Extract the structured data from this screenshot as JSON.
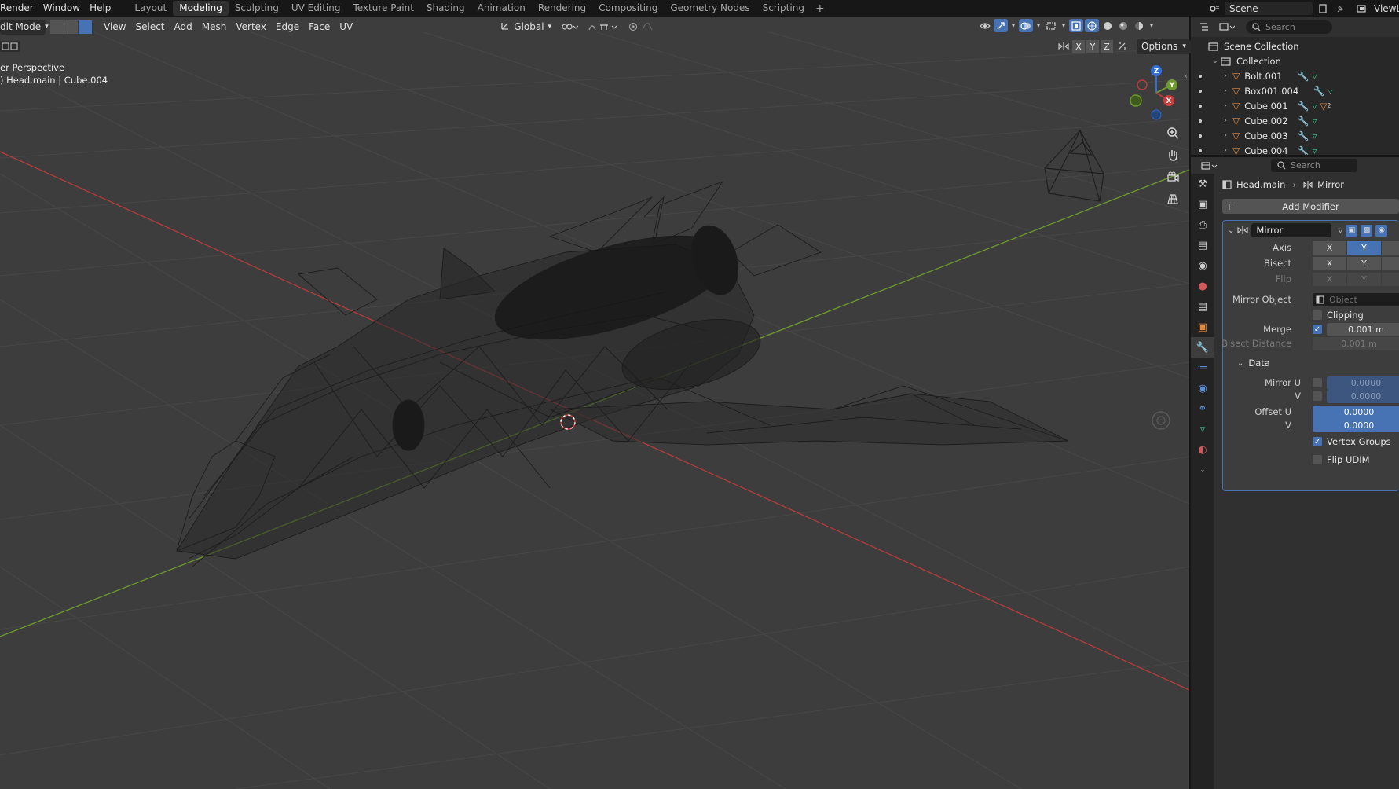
{
  "topbar": {
    "menus": [
      "Render",
      "Window",
      "Help"
    ],
    "tabs": [
      "Layout",
      "Modeling",
      "Sculpting",
      "UV Editing",
      "Texture Paint",
      "Shading",
      "Animation",
      "Rendering",
      "Compositing",
      "Geometry Nodes",
      "Scripting"
    ],
    "active_tab": "Modeling",
    "add_tab": "+",
    "scene": "Scene",
    "view_layer": "ViewLay"
  },
  "viewport": {
    "mode": "dit Mode",
    "menus": [
      "View",
      "Select",
      "Add",
      "Mesh",
      "Vertex",
      "Edge",
      "Face",
      "UV"
    ],
    "orientation": "Global",
    "overlay_line1": "er Perspective",
    "overlay_line2": ") Head.main | Cube.004",
    "axis_buttons": [
      "X",
      "Y",
      "Z"
    ],
    "options": "Options",
    "gizmo_labels": {
      "z": "Z",
      "y": "Y",
      "x": "X"
    },
    "colors": {
      "background": "#3d3d3d",
      "x_axis": "#b53c3c",
      "y_axis": "#6e9a2e",
      "z_gizmo": "#2f6fd6"
    }
  },
  "outliner": {
    "search_placeholder": "Search",
    "root": "Scene Collection",
    "collection": "Collection",
    "items": [
      "Bolt.001",
      "Box001.004",
      "Cube.001",
      "Cube.002",
      "Cube.003",
      "Cube.004"
    ],
    "cube001_badge": "2"
  },
  "properties": {
    "search_placeholder": "Search",
    "breadcrumb_object": "Head.main",
    "breadcrumb_modifier": "Mirror",
    "add_modifier": "Add Modifier",
    "modifier_name": "Mirror",
    "axis_label": "Axis",
    "bisect_label": "Bisect",
    "flip_label": "Flip",
    "axis_x": "X",
    "axis_y": "Y",
    "mirror_object_label": "Mirror Object",
    "mirror_object_placeholder": "Object",
    "clipping_label": "Clipping",
    "merge_label": "Merge",
    "merge_value": "0.001 m",
    "bisect_distance_label": "Bisect Distance",
    "bisect_distance_value": "0.001 m",
    "data_label": "Data",
    "mirror_u_label": "Mirror U",
    "mirror_u_value": "0.0000",
    "v_label": "V",
    "mirror_v_value": "0.0000",
    "offset_u_label": "Offset U",
    "offset_u_value": "0.0000",
    "offset_v_value": "0.0000",
    "vertex_groups_label": "Vertex Groups",
    "flip_udim_label": "Flip UDIM",
    "colors": {
      "accent": "#4772b3"
    }
  }
}
